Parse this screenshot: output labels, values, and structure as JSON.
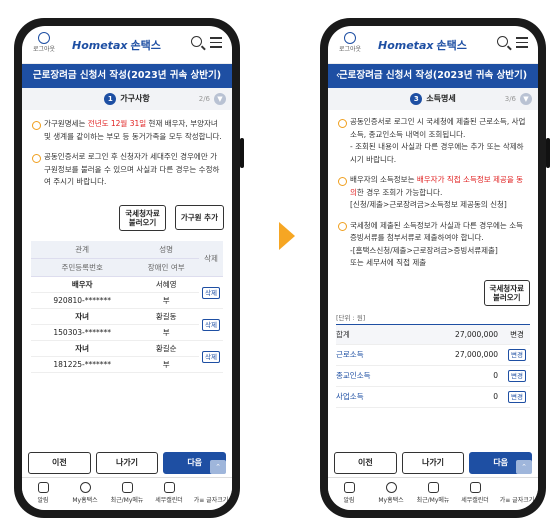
{
  "common": {
    "logout": "로그아웃",
    "logo_brand": "Hometax",
    "logo_kr": "손택스",
    "title": "근로장려금 신청서 작성(2023년 귀속 상반기)",
    "tabbar": [
      "알림",
      "My홈택스",
      "최근/My메뉴",
      "세무캘린더",
      "가≡ 글자크기"
    ]
  },
  "screen1": {
    "step_num": "1",
    "step_label": "가구사항",
    "step_page": "2/6",
    "notes": [
      {
        "a": "가구원명세는 ",
        "red": "전년도 12월 31일",
        "b": " 현재 배우자, 부양자녀 및 생계를 같이하는 부모 등 동거가족을 모두 작성합니다."
      },
      {
        "a": "공동인증서로 로그인 후 신청자가 세대주인 경우에만 가구원정보를 불러올 수 있으며 사실과 다른 경우는 수정하여 주시기 바랍니다.",
        "red": "",
        "b": ""
      }
    ],
    "btn_load": "국세청자료\n불러오기",
    "btn_add": "가구원 추가",
    "th1a": "관계",
    "th1b": "주민등록번호",
    "th2a": "성명",
    "th2b": "장애인 여부",
    "th3": "삭제",
    "rows": [
      {
        "rel": "배우자",
        "name": "서혜영",
        "id": "920810-*******",
        "dis": "부"
      },
      {
        "rel": "자녀",
        "name": "황길동",
        "id": "150303-*******",
        "dis": "부"
      },
      {
        "rel": "자녀",
        "name": "황길순",
        "id": "181225-*******",
        "dis": "부"
      }
    ],
    "del_label": "삭제",
    "prev": "이전",
    "exit": "나가기",
    "next": "다음"
  },
  "screen2": {
    "step_num": "3",
    "step_label": "소득명세",
    "step_page": "3/6",
    "note1": "공동인증서로 로그인 시 국세청에 제출된 근로소득, 사업소득, 종교인소득 내역이 조회됩니다.",
    "note1_sub": "- 조회된 내용이 사실과 다른 경우에는 추가 또는 삭제하시기 바랍니다.",
    "note2_a": "배우자의 소득정보는 ",
    "note2_red": "배우자가 직접 소득정보 제공을 동의",
    "note2_b": "한 경우 조회가 가능합니다.",
    "note2_sub": "[신청/제출>근로장려금>소득정보 제공동의 신청]",
    "note3": "국세청에 제출된 소득정보가 사실과 다른 경우에는 소득증빙서류를 첨부서류로 제출하여야 합니다.",
    "note3_sub1": "-[홈택스신청/제출>근로장려금>증빙서류제출]",
    "note3_sub2": "또는 세무서에 직접 제출",
    "btn_load": "국세청자료\n불러오기",
    "unit": "[단위 : 원]",
    "rows": [
      {
        "label": "합계",
        "value": "27,000,000",
        "edit": "변경"
      },
      {
        "label": "근로소득",
        "value": "27,000,000",
        "edit": "변경"
      },
      {
        "label": "종교인소득",
        "value": "0",
        "edit": "변경"
      },
      {
        "label": "사업소득",
        "value": "0",
        "edit": "변경"
      }
    ],
    "prev": "이전",
    "exit": "나가기",
    "next": "다음"
  }
}
